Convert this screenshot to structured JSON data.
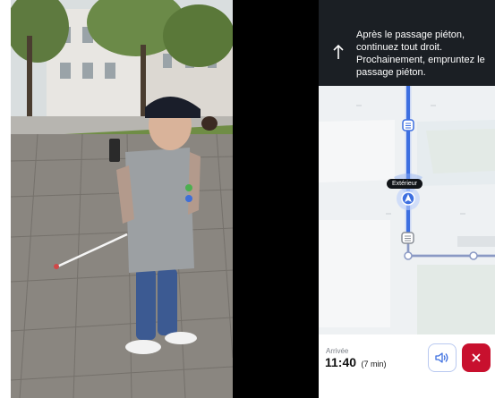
{
  "navigation": {
    "direction_icon": "arrow-up-icon",
    "instruction": "Après le passage piéton, continuez tout droit. Prochainement, empruntez le passage piéton."
  },
  "map": {
    "venue_label": "Extérieur",
    "route_color": "#3d6fe0",
    "current_position_icon": "navigation-arrow-icon"
  },
  "arrival": {
    "label": "Arrivée",
    "time": "11:40",
    "duration": "(7 min)"
  },
  "controls": {
    "sound_icon": "speaker-icon",
    "close_icon": "close-icon",
    "close_color": "#c8102e"
  }
}
